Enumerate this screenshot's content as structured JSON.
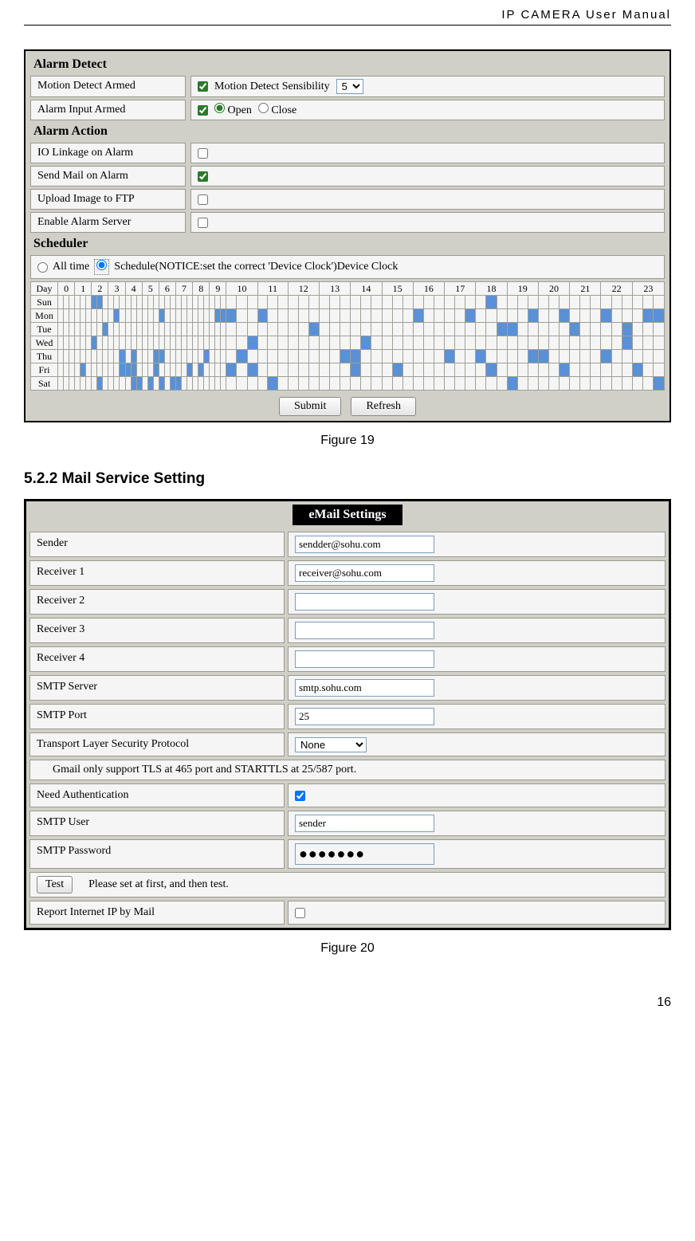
{
  "header": {
    "title": "IP CAMERA User Manual"
  },
  "alarm": {
    "section_detect": "Alarm Detect",
    "motion_label": "Motion Detect Armed",
    "motion_checked": true,
    "motion_sens_label": "Motion Detect Sensibility",
    "motion_sens_value": "5",
    "input_label": "Alarm Input Armed",
    "input_checked": true,
    "open_label": "Open",
    "close_label": "Close",
    "section_action": "Alarm Action",
    "io_label": "IO Linkage on Alarm",
    "io_checked": false,
    "mail_label": "Send Mail on Alarm",
    "mail_checked": true,
    "ftp_label": "Upload Image to FTP",
    "ftp_checked": false,
    "server_label": "Enable Alarm Server",
    "server_checked": false,
    "section_sched": "Scheduler",
    "alltime_label": "All time",
    "schedule_label": "Schedule(NOTICE:set the correct 'Device Clock')Device Clock",
    "day_header": "Day",
    "days": [
      "Sun",
      "Mon",
      "Tue",
      "Wed",
      "Thu",
      "Fri",
      "Sat"
    ],
    "hours": [
      "0",
      "1",
      "2",
      "3",
      "4",
      "5",
      "6",
      "7",
      "8",
      "9",
      "10",
      "11",
      "12",
      "13",
      "14",
      "15",
      "16",
      "17",
      "18",
      "19",
      "20",
      "21",
      "22",
      "23"
    ],
    "submit": "Submit",
    "refresh": "Refresh",
    "caption": "Figure 19"
  },
  "schedule_grid": {
    "Sun": [
      0,
      0,
      0,
      0,
      0,
      0,
      1,
      1,
      0,
      0,
      0,
      0,
      0,
      0,
      0,
      0,
      0,
      0,
      0,
      0,
      0,
      0,
      0,
      0,
      0,
      0,
      0,
      0,
      0,
      0,
      0,
      0,
      0,
      0,
      0,
      0,
      0,
      0,
      0,
      0,
      0,
      0,
      0,
      0,
      0,
      0,
      0,
      0,
      0,
      0,
      0,
      0,
      0,
      0,
      0,
      1,
      0,
      0,
      0,
      0,
      0,
      0,
      0,
      0,
      0,
      0,
      0,
      0,
      0,
      0,
      0,
      0
    ],
    "Mon": [
      0,
      0,
      0,
      0,
      0,
      0,
      0,
      0,
      0,
      0,
      1,
      0,
      0,
      0,
      0,
      0,
      0,
      0,
      1,
      0,
      0,
      0,
      0,
      0,
      0,
      0,
      0,
      0,
      1,
      1,
      1,
      0,
      0,
      1,
      0,
      0,
      0,
      0,
      0,
      0,
      0,
      0,
      0,
      0,
      0,
      0,
      0,
      0,
      1,
      0,
      0,
      0,
      0,
      1,
      0,
      0,
      0,
      0,
      0,
      1,
      0,
      0,
      1,
      0,
      0,
      0,
      1,
      0,
      0,
      0,
      1,
      1
    ],
    "Tue": [
      0,
      0,
      0,
      0,
      0,
      0,
      0,
      0,
      1,
      0,
      0,
      0,
      0,
      0,
      0,
      0,
      0,
      0,
      0,
      0,
      0,
      0,
      0,
      0,
      0,
      0,
      0,
      0,
      0,
      0,
      0,
      0,
      0,
      0,
      0,
      0,
      0,
      0,
      1,
      0,
      0,
      0,
      0,
      0,
      0,
      0,
      0,
      0,
      0,
      0,
      0,
      0,
      0,
      0,
      0,
      0,
      1,
      1,
      0,
      0,
      0,
      0,
      0,
      1,
      0,
      0,
      0,
      0,
      1,
      0,
      0,
      0
    ],
    "Wed": [
      0,
      0,
      0,
      0,
      0,
      0,
      1,
      0,
      0,
      0,
      0,
      0,
      0,
      0,
      0,
      0,
      0,
      0,
      0,
      0,
      0,
      0,
      0,
      0,
      0,
      0,
      0,
      0,
      0,
      0,
      0,
      0,
      1,
      0,
      0,
      0,
      0,
      0,
      0,
      0,
      0,
      0,
      0,
      1,
      0,
      0,
      0,
      0,
      0,
      0,
      0,
      0,
      0,
      0,
      0,
      0,
      0,
      0,
      0,
      0,
      0,
      0,
      0,
      0,
      0,
      0,
      0,
      0,
      1,
      0,
      0,
      0
    ],
    "Thu": [
      0,
      0,
      0,
      0,
      0,
      0,
      0,
      0,
      0,
      0,
      0,
      1,
      0,
      1,
      0,
      0,
      0,
      1,
      1,
      0,
      0,
      0,
      0,
      0,
      0,
      0,
      1,
      0,
      0,
      0,
      0,
      1,
      0,
      0,
      0,
      0,
      0,
      0,
      0,
      0,
      0,
      1,
      1,
      0,
      0,
      0,
      0,
      0,
      0,
      0,
      0,
      1,
      0,
      0,
      1,
      0,
      0,
      0,
      0,
      1,
      1,
      0,
      0,
      0,
      0,
      0,
      1,
      0,
      0,
      0,
      0,
      0
    ],
    "Fri": [
      0,
      0,
      0,
      0,
      1,
      0,
      0,
      0,
      0,
      0,
      0,
      1,
      1,
      1,
      0,
      0,
      0,
      1,
      0,
      0,
      0,
      0,
      0,
      1,
      0,
      1,
      0,
      0,
      0,
      0,
      1,
      0,
      1,
      0,
      0,
      0,
      0,
      0,
      0,
      0,
      0,
      0,
      1,
      0,
      0,
      0,
      1,
      0,
      0,
      0,
      0,
      0,
      0,
      0,
      0,
      1,
      0,
      0,
      0,
      0,
      0,
      0,
      1,
      0,
      0,
      0,
      0,
      0,
      0,
      1,
      0,
      0
    ],
    "Sat": [
      0,
      0,
      0,
      0,
      0,
      0,
      0,
      1,
      0,
      0,
      0,
      0,
      0,
      1,
      1,
      0,
      1,
      0,
      1,
      0,
      1,
      1,
      0,
      0,
      0,
      0,
      0,
      0,
      0,
      0,
      0,
      0,
      0,
      0,
      1,
      0,
      0,
      0,
      0,
      0,
      0,
      0,
      0,
      0,
      0,
      0,
      0,
      0,
      0,
      0,
      0,
      0,
      0,
      0,
      0,
      0,
      0,
      1,
      0,
      0,
      0,
      0,
      0,
      0,
      0,
      0,
      0,
      0,
      0,
      0,
      0,
      1
    ]
  },
  "section_heading": "5.2.2   Mail Service Setting",
  "mail": {
    "title": "eMail Settings",
    "sender_label": "Sender",
    "sender_value": "sendder@sohu.com",
    "r1_label": "Receiver 1",
    "r1_value": "receiver@sohu.com",
    "r2_label": "Receiver 2",
    "r2_value": "",
    "r3_label": "Receiver 3",
    "r3_value": "",
    "r4_label": "Receiver 4",
    "r4_value": "",
    "smtp_server_label": "SMTP Server",
    "smtp_server_value": "smtp.sohu.com",
    "smtp_port_label": "SMTP Port",
    "smtp_port_value": "25",
    "tls_label": "Transport Layer Security Protocol",
    "tls_value": "None",
    "tls_note": "Gmail only support TLS at 465 port and STARTTLS at 25/587 port.",
    "need_auth_label": "Need Authentication",
    "need_auth_checked": true,
    "smtp_user_label": " SMTP User",
    "smtp_user_value": "sender",
    "smtp_pwd_label": " SMTP Password",
    "smtp_pwd_value": "●●●●●●●",
    "test_btn": "Test",
    "test_note": "Please set at first, and then test.",
    "report_label": "Report Internet IP by Mail",
    "report_checked": false,
    "caption": "Figure 20"
  },
  "page_number": "16"
}
